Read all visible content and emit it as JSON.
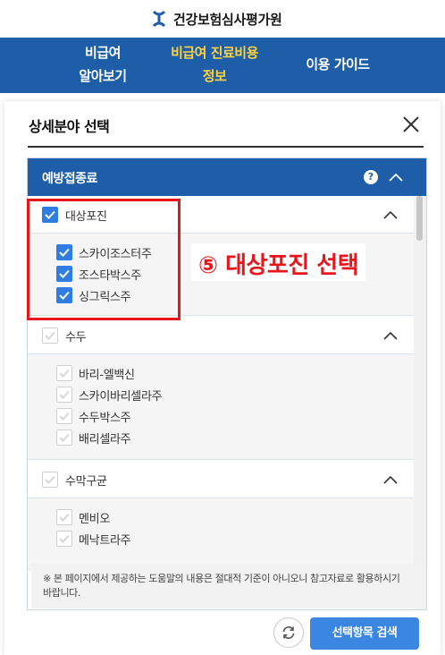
{
  "site": {
    "logo_text": "건강보험심사평가원",
    "logo_icon": "hira-logo-icon"
  },
  "nav": {
    "item1_line1": "비급여",
    "item1_line2": "알아보기",
    "item2_line1": "비급여 진료비용",
    "item2_line2": "정보",
    "item3": "이용 가이드",
    "active_color": "#ffd23f",
    "bar_color": "#1e5ea8"
  },
  "modal": {
    "title": "상세분야 선택",
    "close_icon": "close-icon"
  },
  "panel": {
    "title": "예방접종료",
    "help_icon": "?",
    "groups": [
      {
        "label": "대상포진",
        "checked": true,
        "expanded": true,
        "items": [
          {
            "label": "스카이조스터주",
            "checked": true
          },
          {
            "label": "조스타박스주",
            "checked": true
          },
          {
            "label": "싱그릭스주",
            "checked": true
          }
        ]
      },
      {
        "label": "수두",
        "checked": false,
        "expanded": true,
        "items": [
          {
            "label": "바리-엘백신",
            "checked": false
          },
          {
            "label": "스카이바리셀라주",
            "checked": false
          },
          {
            "label": "수두박스주",
            "checked": false
          },
          {
            "label": "배리셀라주",
            "checked": false
          }
        ]
      },
      {
        "label": "수막구균",
        "checked": false,
        "expanded": true,
        "items": [
          {
            "label": "멘비오",
            "checked": false
          },
          {
            "label": "메낙트라주",
            "checked": false
          }
        ]
      }
    ]
  },
  "annotation": {
    "text": "⑤ 대상포진 선택",
    "color": "#e8161b"
  },
  "note": "※ 본 페이지에서 제공하는 도움말의 내용은 절대적 기준이 아니오니 참고자료로 활용하시기 바랍니다.",
  "buttons": {
    "reset_icon": "refresh-icon",
    "search_label": "선택항목 검색",
    "accent": "#3a86e0"
  }
}
